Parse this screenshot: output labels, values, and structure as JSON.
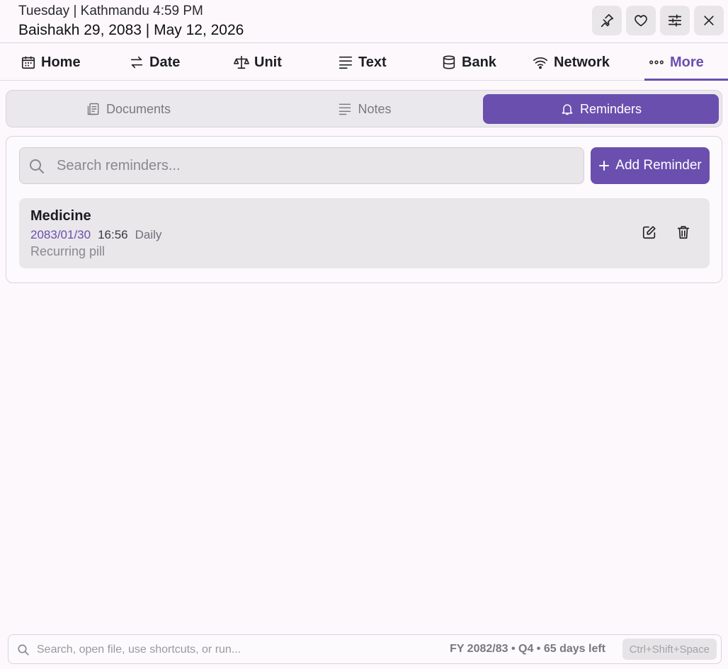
{
  "header": {
    "line1": "Tuesday | Kathmandu 4:59 PM",
    "line2": "Baishakh 29, 2083 | May 12, 2026",
    "buttons": [
      "pin-icon",
      "heart-icon",
      "sliders-icon",
      "close-icon"
    ]
  },
  "nav": {
    "items": [
      {
        "label": "Home",
        "icon": "calendar-icon"
      },
      {
        "label": "Date",
        "icon": "swap-arrows-icon"
      },
      {
        "label": "Unit",
        "icon": "scale-icon"
      },
      {
        "label": "Text",
        "icon": "text-lines-icon"
      },
      {
        "label": "Bank",
        "icon": "database-icon"
      },
      {
        "label": "Network",
        "icon": "wifi-icon"
      },
      {
        "label": "More",
        "icon": "more-dots-icon"
      }
    ],
    "active": "More"
  },
  "subtabs": {
    "items": [
      {
        "label": "Documents",
        "icon": "document-icon"
      },
      {
        "label": "Notes",
        "icon": "notes-icon"
      },
      {
        "label": "Reminders",
        "icon": "bell-icon"
      }
    ],
    "active": "Reminders"
  },
  "reminders": {
    "search_placeholder": "Search reminders...",
    "search_value": "",
    "add_label": "Add Reminder",
    "list": [
      {
        "title": "Medicine",
        "date": "2083/01/30",
        "time": "16:56",
        "frequency": "Daily",
        "description": "Recurring pill"
      }
    ]
  },
  "footer": {
    "search_placeholder": "Search, open file, use shortcuts, or run...",
    "fy_info": "FY 2082/83 • Q4 • 65 days left",
    "shortcut": "Ctrl+Shift+Space"
  },
  "colors": {
    "accent": "#6a4fae",
    "background": "#fcf8fc"
  }
}
